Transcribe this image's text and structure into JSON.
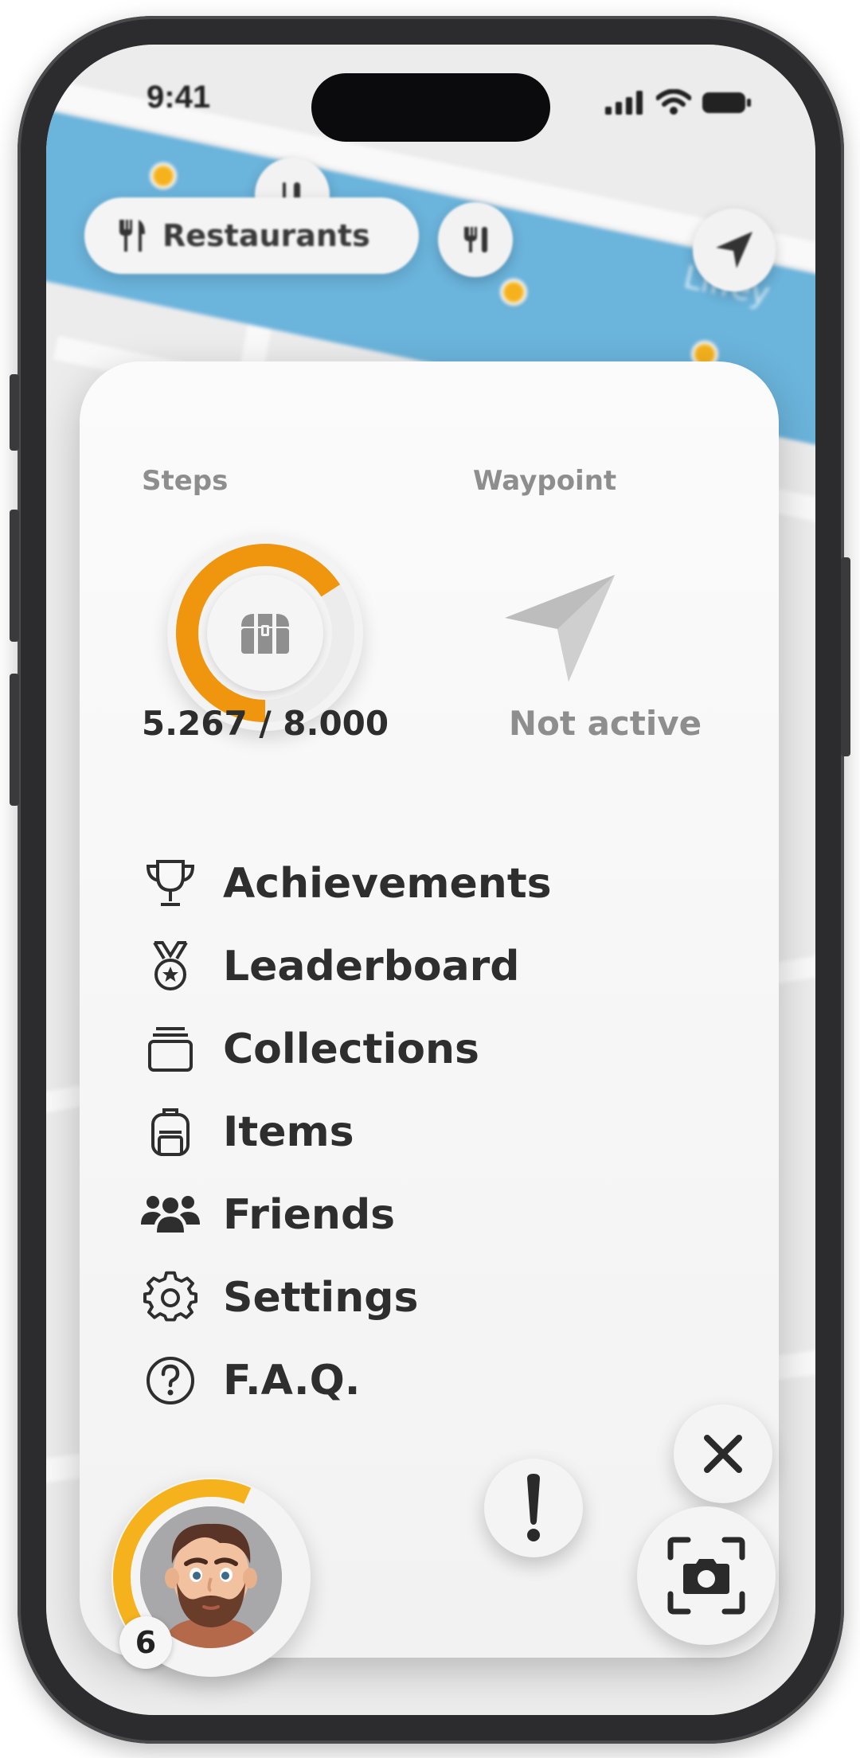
{
  "status_bar": {
    "time": "9:41"
  },
  "map": {
    "river_label": "Liffey",
    "filter_chip": {
      "label": "Restaurants",
      "icon": "fork-knife-icon"
    }
  },
  "stats": {
    "steps": {
      "label": "Steps",
      "value": "5.267 / 8.000",
      "current": 5267,
      "goal": 8000,
      "icon": "treasure-chest-icon",
      "ring_color": "#f0950e"
    },
    "waypoint": {
      "label": "Waypoint",
      "value": "Not active",
      "icon": "navigation-arrow-icon"
    }
  },
  "menu": {
    "items": [
      {
        "label": "Achievements",
        "icon": "trophy-icon"
      },
      {
        "label": "Leaderboard",
        "icon": "medal-icon"
      },
      {
        "label": "Collections",
        "icon": "stack-icon"
      },
      {
        "label": "Items",
        "icon": "backpack-icon"
      },
      {
        "label": "Friends",
        "icon": "users-icon"
      },
      {
        "label": "Settings",
        "icon": "gear-icon"
      },
      {
        "label": "F.A.Q.",
        "icon": "question-circle-icon"
      }
    ]
  },
  "profile": {
    "level": "6",
    "level_progress": 0.4,
    "ring_color": "#f5b21d"
  },
  "actions": {
    "alert": {
      "icon": "exclamation-icon"
    },
    "close": {
      "icon": "close-icon"
    },
    "camera": {
      "icon": "camera-scan-icon"
    }
  }
}
